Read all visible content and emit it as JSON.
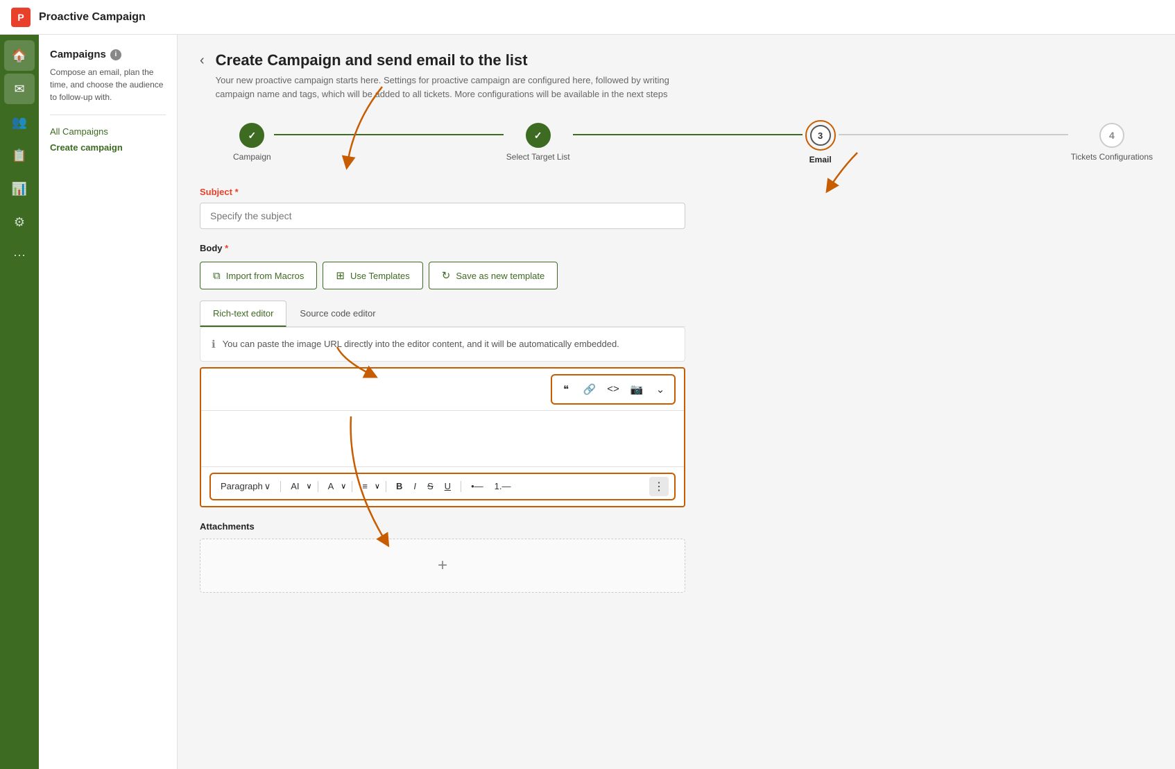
{
  "app": {
    "logo_letter": "P",
    "title": "Proactive Campaign"
  },
  "icon_nav": {
    "items": [
      {
        "icon": "🏠",
        "label": "home-icon",
        "active": false
      },
      {
        "icon": "✉",
        "label": "email-icon",
        "active": true
      },
      {
        "icon": "👥",
        "label": "contacts-icon",
        "active": false
      },
      {
        "icon": "📋",
        "label": "list-icon",
        "active": false
      },
      {
        "icon": "📊",
        "label": "reports-icon",
        "active": false
      },
      {
        "icon": "⚙",
        "label": "settings-icon",
        "active": false
      },
      {
        "icon": "⋯",
        "label": "more-icon",
        "active": false
      }
    ]
  },
  "sidebar": {
    "title": "Campaigns",
    "description": "Compose an email, plan the time, and choose the audience to follow-up with.",
    "links": [
      {
        "label": "All Campaigns",
        "active": false
      },
      {
        "label": "Create campaign",
        "active": true
      }
    ]
  },
  "page_header": {
    "title": "Create Campaign and send email to the list",
    "description": "Your new proactive campaign starts here. Settings for proactive campaign are configured here, followed by writing campaign name and tags, which will be added to all tickets. More configurations will be available in the next steps"
  },
  "steps": [
    {
      "number": "✓",
      "label": "Campaign",
      "state": "done"
    },
    {
      "number": "✓",
      "label": "Select Target List",
      "state": "done"
    },
    {
      "number": "3",
      "label": "Email",
      "state": "active"
    },
    {
      "number": "4",
      "label": "Tickets Configurations",
      "state": "pending"
    }
  ],
  "form": {
    "subject_label": "Subject",
    "subject_required": "*",
    "subject_placeholder": "Specify the subject",
    "body_label": "Body",
    "body_required": "*"
  },
  "action_buttons": [
    {
      "label": "Import from Macros",
      "icon": "⧉"
    },
    {
      "label": "Use Templates",
      "icon": "⊞"
    },
    {
      "label": "Save as new template",
      "icon": "⟳"
    }
  ],
  "editor_tabs": [
    {
      "label": "Rich-text editor",
      "active": true
    },
    {
      "label": "Source code editor",
      "active": false
    }
  ],
  "info_box": {
    "text": "You can paste the image URL directly into the editor content, and it will be automatically embedded."
  },
  "editor_toolbar_top": {
    "buttons": [
      {
        "icon": "❝",
        "label": "quote-btn"
      },
      {
        "icon": "🔗",
        "label": "link-btn"
      },
      {
        "icon": "<>",
        "label": "code-btn"
      },
      {
        "icon": "🖼",
        "label": "image-btn"
      },
      {
        "icon": "∨",
        "label": "more-btn"
      }
    ]
  },
  "editor_toolbar_bottom": {
    "paragraph_label": "Paragraph",
    "buttons": [
      {
        "label": "AI",
        "type": "text"
      },
      {
        "label": "A",
        "type": "underline-a"
      },
      {
        "label": "≡",
        "type": "align"
      },
      {
        "label": "B",
        "type": "bold"
      },
      {
        "label": "I",
        "type": "italic"
      },
      {
        "label": "S",
        "type": "strike"
      },
      {
        "label": "U",
        "type": "underline"
      },
      {
        "label": "•",
        "type": "bullet"
      },
      {
        "label": "1.",
        "type": "ordered"
      },
      {
        "label": "⋮",
        "type": "more"
      }
    ]
  },
  "attachments": {
    "label": "Attachments",
    "plus": "+"
  }
}
